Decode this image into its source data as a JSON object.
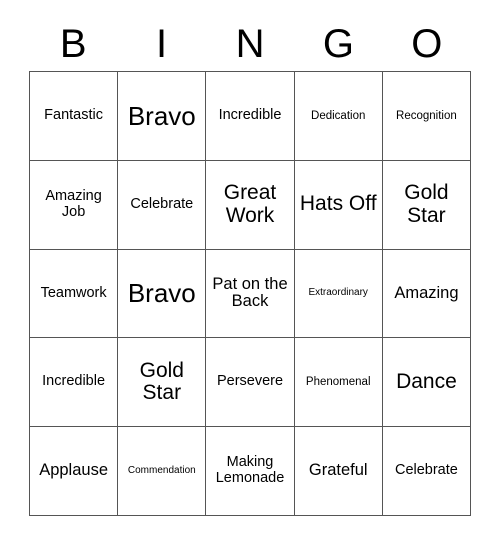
{
  "card": {
    "title_letters": [
      "B",
      "I",
      "N",
      "G",
      "O"
    ],
    "border_color": "#555555",
    "background_color": "#ffffff",
    "text_color": "#000000",
    "rows": [
      [
        {
          "label": "Fantastic",
          "size": "sz-m"
        },
        {
          "label": "Bravo",
          "size": "sz-xxl"
        },
        {
          "label": "Incredible",
          "size": "sz-m"
        },
        {
          "label": "Dedication",
          "size": "sz-s"
        },
        {
          "label": "Recognition",
          "size": "sz-s"
        }
      ],
      [
        {
          "label": "Amazing Job",
          "size": "sz-m"
        },
        {
          "label": "Celebrate",
          "size": "sz-m"
        },
        {
          "label": "Great Work",
          "size": "sz-xl"
        },
        {
          "label": "Hats Off",
          "size": "sz-xl"
        },
        {
          "label": "Gold Star",
          "size": "sz-xl"
        }
      ],
      [
        {
          "label": "Teamwork",
          "size": "sz-m"
        },
        {
          "label": "Bravo",
          "size": "sz-xxl"
        },
        {
          "label": "Pat on the Back",
          "size": "sz-l"
        },
        {
          "label": "Extraordinary",
          "size": "sz-xs"
        },
        {
          "label": "Amazing",
          "size": "sz-l"
        }
      ],
      [
        {
          "label": "Incredible",
          "size": "sz-m"
        },
        {
          "label": "Gold Star",
          "size": "sz-xl"
        },
        {
          "label": "Persevere",
          "size": "sz-m"
        },
        {
          "label": "Phenomenal",
          "size": "sz-s"
        },
        {
          "label": "Dance",
          "size": "sz-xl"
        }
      ],
      [
        {
          "label": "Applause",
          "size": "sz-l"
        },
        {
          "label": "Commendation",
          "size": "sz-xs"
        },
        {
          "label": "Making Lemonade",
          "size": "sz-m"
        },
        {
          "label": "Grateful",
          "size": "sz-l"
        },
        {
          "label": "Celebrate",
          "size": "sz-m"
        }
      ]
    ]
  }
}
